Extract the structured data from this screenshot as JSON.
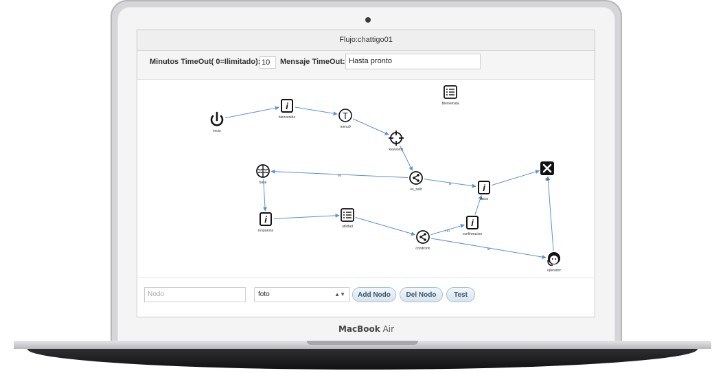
{
  "device": {
    "brand": "MacBook",
    "model": "Air"
  },
  "app": {
    "title": "Flujo:chattigo01",
    "timeout_label": "Minutos TimeOut( 0=Ilimitado):",
    "timeout_value": "10",
    "message_label": "Mensaje TimeOut:",
    "message_value": "Hasta pronto"
  },
  "graph": {
    "nodes": [
      {
        "id": "inicio",
        "label": "inicio",
        "icon": "power-icon"
      },
      {
        "id": "bienvenida",
        "label": "bienvenida",
        "icon": "info-icon"
      },
      {
        "id": "menu0",
        "label": "menu0",
        "icon": "text-t-icon"
      },
      {
        "id": "keywords",
        "label": "keywords",
        "icon": "crosshair-icon"
      },
      {
        "id": "Bienvenida2",
        "label": "Bienvenida",
        "icon": "list-icon"
      },
      {
        "id": "base",
        "label": "base",
        "icon": "brain-icon"
      },
      {
        "id": "es_salir",
        "label": "es_salir",
        "icon": "share-icon"
      },
      {
        "id": "datos",
        "label": "datos",
        "icon": "info-icon"
      },
      {
        "id": "fin",
        "label": "fin",
        "icon": "close-box-icon"
      },
      {
        "id": "respuesta",
        "label": "respuesta",
        "icon": "info-icon"
      },
      {
        "id": "utilidad",
        "label": "utilidad",
        "icon": "list-icon"
      },
      {
        "id": "confirmacion",
        "label": "confirmacion",
        "icon": "info-icon"
      },
      {
        "id": "condicion",
        "label": "condicion",
        "icon": "share-icon"
      },
      {
        "id": "operador",
        "label": "operador",
        "icon": "agent-icon"
      }
    ],
    "edges": [
      {
        "from": "inicio",
        "to": "bienvenida",
        "label": ""
      },
      {
        "from": "bienvenida",
        "to": "menu0",
        "label": ""
      },
      {
        "from": "menu0",
        "to": "keywords",
        "label": ""
      },
      {
        "from": "keywords",
        "to": "es_salir",
        "label": ""
      },
      {
        "from": "es_salir",
        "to": "base",
        "label": "no"
      },
      {
        "from": "es_salir",
        "to": "datos",
        "label": "si"
      },
      {
        "from": "datos",
        "to": "fin",
        "label": ""
      },
      {
        "from": "base",
        "to": "respuesta",
        "label": ""
      },
      {
        "from": "respuesta",
        "to": "utilidad",
        "label": ""
      },
      {
        "from": "utilidad",
        "to": "condicion",
        "label": ""
      },
      {
        "from": "condicion",
        "to": "confirmacion",
        "label": "no"
      },
      {
        "from": "confirmacion",
        "to": "datos",
        "label": ""
      },
      {
        "from": "condicion",
        "to": "operador",
        "label": "si"
      },
      {
        "from": "operador",
        "to": "fin",
        "label": ""
      }
    ]
  },
  "controls": {
    "nodo_placeholder": "Nodo",
    "type_select_value": "foto",
    "add_button": "Add Nodo",
    "del_button": "Del Nodo",
    "test_button": "Test"
  },
  "colors": {
    "edge": "#5b8fd9",
    "button_text": "#3b5568"
  }
}
